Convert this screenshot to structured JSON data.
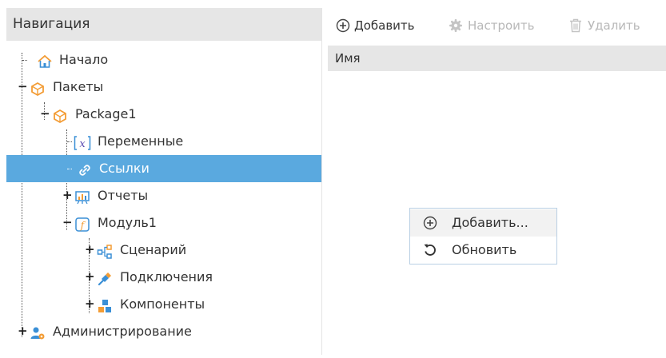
{
  "nav": {
    "title": "Навигация",
    "tree": {
      "home": "Начало",
      "packages": "Пакеты",
      "package1": "Package1",
      "variables": "Переменные",
      "links": "Ссылки",
      "reports": "Отчеты",
      "module1": "Модуль1",
      "scenario": "Сценарий",
      "connections": "Подключения",
      "components": "Компоненты",
      "administration": "Администрирование"
    },
    "selected_item": "Ссылки"
  },
  "toolbar": {
    "add_label": "Добавить",
    "configure_label": "Настроить",
    "delete_label": "Удалить"
  },
  "grid": {
    "column_name": "Имя"
  },
  "context_menu": {
    "add_label": "Добавить...",
    "refresh_label": "Обновить"
  },
  "colors": {
    "selection": "#5aa9df",
    "header_bg": "#e6e6e6",
    "accent_orange": "#f39c34",
    "accent_blue": "#3a8fd6"
  }
}
